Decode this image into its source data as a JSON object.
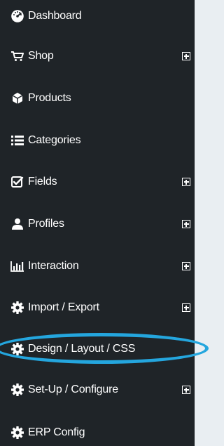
{
  "sidebar": {
    "items": [
      {
        "label": "Dashboard",
        "icon": "dashboard-icon",
        "expandable": false
      },
      {
        "label": "Shop",
        "icon": "cart-icon",
        "expandable": true
      },
      {
        "label": "Products",
        "icon": "cube-icon",
        "expandable": false
      },
      {
        "label": "Categories",
        "icon": "list-icon",
        "expandable": false
      },
      {
        "label": "Fields",
        "icon": "checkbox-icon",
        "expandable": true
      },
      {
        "label": "Profiles",
        "icon": "user-icon",
        "expandable": true
      },
      {
        "label": "Interaction",
        "icon": "bar-chart-icon",
        "expandable": true
      },
      {
        "label": "Import / Export",
        "icon": "gear-icon",
        "expandable": true
      },
      {
        "label": "Design / Layout / CSS",
        "icon": "gear-icon",
        "expandable": false
      },
      {
        "label": "Set-Up / Configure",
        "icon": "gear-icon",
        "expandable": true
      },
      {
        "label": "ERP Config",
        "icon": "gear-icon",
        "expandable": false
      }
    ],
    "highlighted_item": "Design / Layout / CSS"
  },
  "colors": {
    "sidebar_bg": "#1f2428",
    "text": "#ffffff",
    "highlight": "#24a6de",
    "page_bg": "#e9eef2"
  }
}
